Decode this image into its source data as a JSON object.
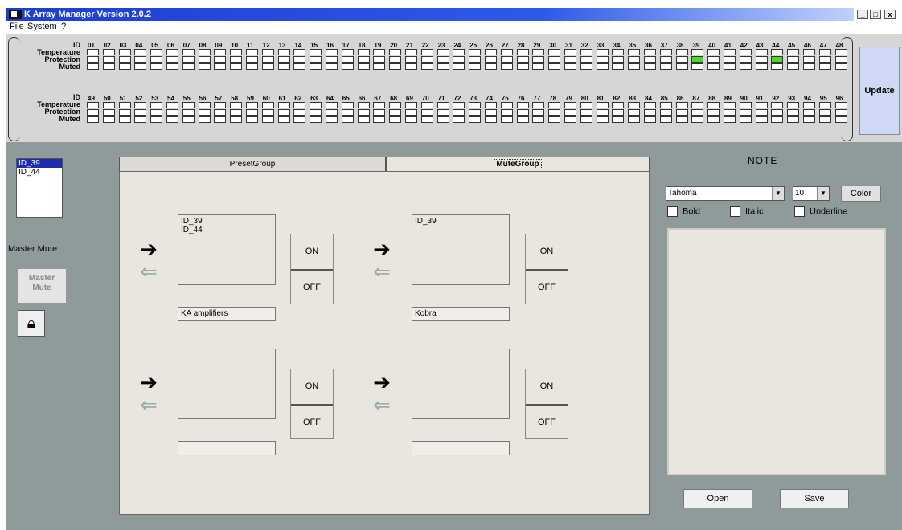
{
  "window": {
    "title": "K Array Manager Version 2.0.2",
    "minimize": "_",
    "maximize": "□",
    "close": "x"
  },
  "menu": [
    "File",
    "System",
    "?"
  ],
  "grid": {
    "row_labels": [
      "ID",
      "Temperature",
      "Protection",
      "Muted"
    ],
    "ids_top": [
      "01",
      "02",
      "03",
      "04",
      "05",
      "06",
      "07",
      "08",
      "09",
      "10",
      "11",
      "12",
      "13",
      "14",
      "15",
      "16",
      "17",
      "18",
      "19",
      "20",
      "21",
      "22",
      "23",
      "24",
      "25",
      "26",
      "27",
      "28",
      "29",
      "30",
      "31",
      "32",
      "33",
      "34",
      "35",
      "36",
      "37",
      "38",
      "39",
      "40",
      "41",
      "42",
      "43",
      "44",
      "45",
      "46",
      "47",
      "48"
    ],
    "ids_bottom": [
      "49",
      "50",
      "51",
      "52",
      "53",
      "54",
      "55",
      "56",
      "57",
      "58",
      "59",
      "60",
      "61",
      "62",
      "63",
      "64",
      "65",
      "66",
      "67",
      "68",
      "69",
      "70",
      "71",
      "72",
      "73",
      "74",
      "75",
      "76",
      "77",
      "78",
      "79",
      "80",
      "81",
      "82",
      "83",
      "84",
      "85",
      "86",
      "87",
      "88",
      "89",
      "90",
      "91",
      "92",
      "93",
      "94",
      "95",
      "96"
    ],
    "active_ids": [
      "39",
      "44"
    ],
    "active_color": "#49dd22"
  },
  "update_label": "Update",
  "id_list": {
    "items": [
      "ID_39",
      "ID_44"
    ],
    "selected": "ID_39"
  },
  "master_mute_label": "Master Mute",
  "master_mute_button": "Master\nMute",
  "lock_icon": "lock-icon",
  "tabs": [
    {
      "label": "PresetGroup",
      "active": false
    },
    {
      "label": "MuteGroup",
      "active": true
    }
  ],
  "groups": [
    {
      "members": "ID_39\nID_44",
      "name": "KA amplifiers",
      "on": "ON",
      "off": "OFF"
    },
    {
      "members": "ID_39",
      "name": "Kobra",
      "on": "ON",
      "off": "OFF"
    },
    {
      "members": "",
      "name": "",
      "on": "ON",
      "off": "OFF"
    },
    {
      "members": "",
      "name": "",
      "on": "ON",
      "off": "OFF"
    }
  ],
  "note": {
    "title": "NOTE",
    "font": "Tahoma",
    "size": "10",
    "color_button": "Color",
    "bold": "Bold",
    "italic": "Italic",
    "underline": "Underline",
    "text": "",
    "open_button": "Open",
    "save_button": "Save"
  }
}
